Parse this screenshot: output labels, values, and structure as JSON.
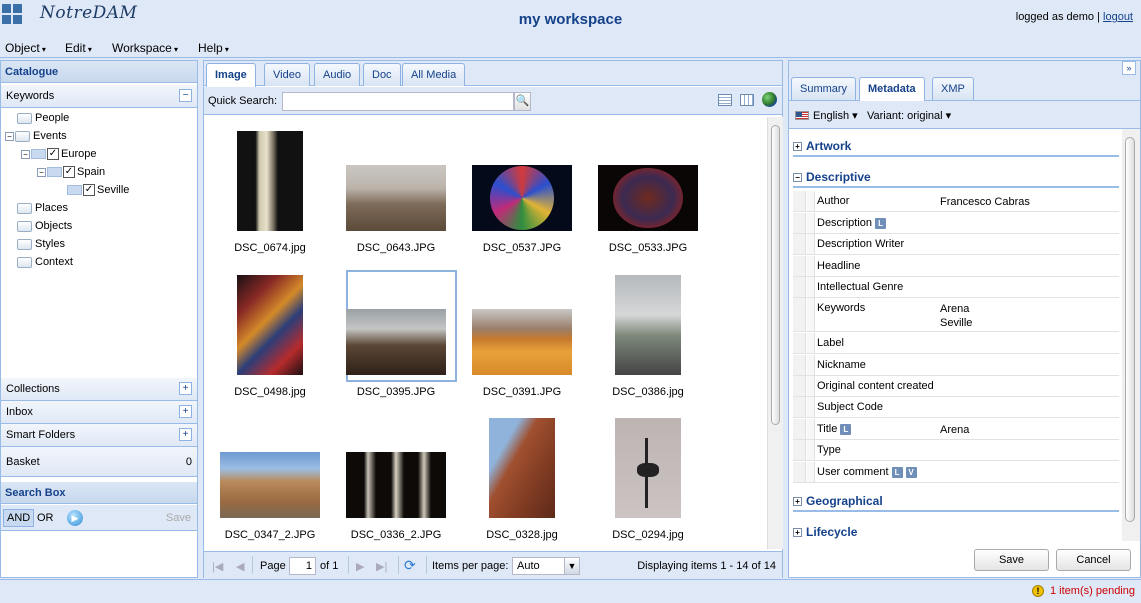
{
  "app": {
    "logo_text": "NotreDAM",
    "workspace_title": "my workspace",
    "logged_as": "logged as demo |",
    "logout_label": "logout"
  },
  "menu": [
    "Object",
    "Edit",
    "Workspace",
    "Help"
  ],
  "left": {
    "catalogue_title": "Catalogue",
    "keywords_label": "Keywords",
    "tree": [
      "People",
      "Events",
      "Europe",
      "Spain",
      "Seville",
      "Places",
      "Objects",
      "Styles",
      "Context"
    ],
    "collections_label": "Collections",
    "inbox_label": "Inbox",
    "smart_folders_label": "Smart Folders",
    "basket_label": "Basket",
    "basket_count": "0",
    "search_box_title": "Search Box",
    "and_label": "AND",
    "or_label": "OR",
    "save_label": "Save"
  },
  "center": {
    "tabs": [
      "Image",
      "Video",
      "Audio",
      "Doc",
      "All Media"
    ],
    "quick_search_label": "Quick Search:",
    "quick_search_value": "",
    "thumbnails": [
      "DSC_0674.jpg",
      "DSC_0643.JPG",
      "DSC_0537.JPG",
      "DSC_0533.JPG",
      "DSC_0498.jpg",
      "DSC_0395.JPG",
      "DSC_0391.JPG",
      "DSC_0386.jpg",
      "DSC_0347_2.JPG",
      "DSC_0336_2.JPG",
      "DSC_0328.jpg",
      "DSC_0294.jpg"
    ],
    "pager": {
      "page_label": "Page",
      "page_value": "1",
      "of_label": "of 1",
      "items_per_page_label": "Items per page:",
      "items_per_page_value": "Auto",
      "displaying": "Displaying items 1 - 14 of 14"
    }
  },
  "right": {
    "tabs": [
      "Summary",
      "Metadata",
      "XMP"
    ],
    "language": "English",
    "variant": "Variant: original",
    "sections": [
      "Artwork",
      "Descriptive",
      "Geographical",
      "Lifecycle"
    ],
    "fields": [
      {
        "key": "Author",
        "value": "Francesco Cabras"
      },
      {
        "key": "Description",
        "value": ""
      },
      {
        "key": "Description Writer",
        "value": ""
      },
      {
        "key": "Headline",
        "value": ""
      },
      {
        "key": "Intellectual Genre",
        "value": ""
      },
      {
        "key": "Keywords",
        "value": "Arena",
        "value2": "Seville"
      },
      {
        "key": "Label",
        "value": ""
      },
      {
        "key": "Nickname",
        "value": ""
      },
      {
        "key": "Original content created",
        "value": ""
      },
      {
        "key": "Subject Code",
        "value": ""
      },
      {
        "key": "Title",
        "value": "Arena"
      },
      {
        "key": "Type",
        "value": ""
      },
      {
        "key": "User comment",
        "value": ""
      }
    ],
    "badge_l": "L",
    "badge_v": "V",
    "save_label": "Save",
    "cancel_label": "Cancel"
  },
  "status": {
    "pending": "1 item(s) pending"
  }
}
